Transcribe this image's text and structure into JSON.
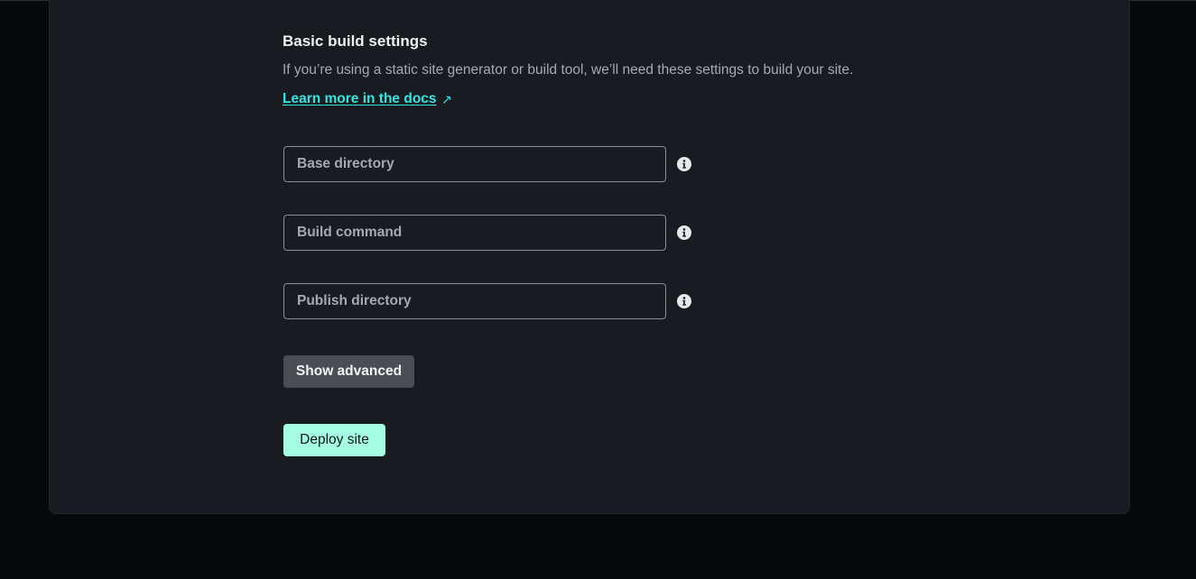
{
  "section": {
    "heading": "Basic build settings",
    "description": "If you’re using a static site generator or build tool, we’ll need these settings to build your site.",
    "docs_link": "Learn more in the docs",
    "docs_link_arrow": "↗"
  },
  "fields": {
    "base_directory": {
      "placeholder": "Base directory",
      "value": ""
    },
    "build_command": {
      "placeholder": "Build command",
      "value": ""
    },
    "publish_directory": {
      "placeholder": "Publish directory",
      "value": ""
    }
  },
  "buttons": {
    "show_advanced": "Show advanced",
    "deploy": "Deploy site"
  },
  "colors": {
    "page_background": "#06090c",
    "card_background": "#181b20",
    "link_accent": "#32e6e2",
    "deploy_button": "#a6fce3",
    "secondary_button": "#4a4d53"
  },
  "icons": {
    "info": "info-icon",
    "external_link": "external-link-arrow-icon"
  }
}
